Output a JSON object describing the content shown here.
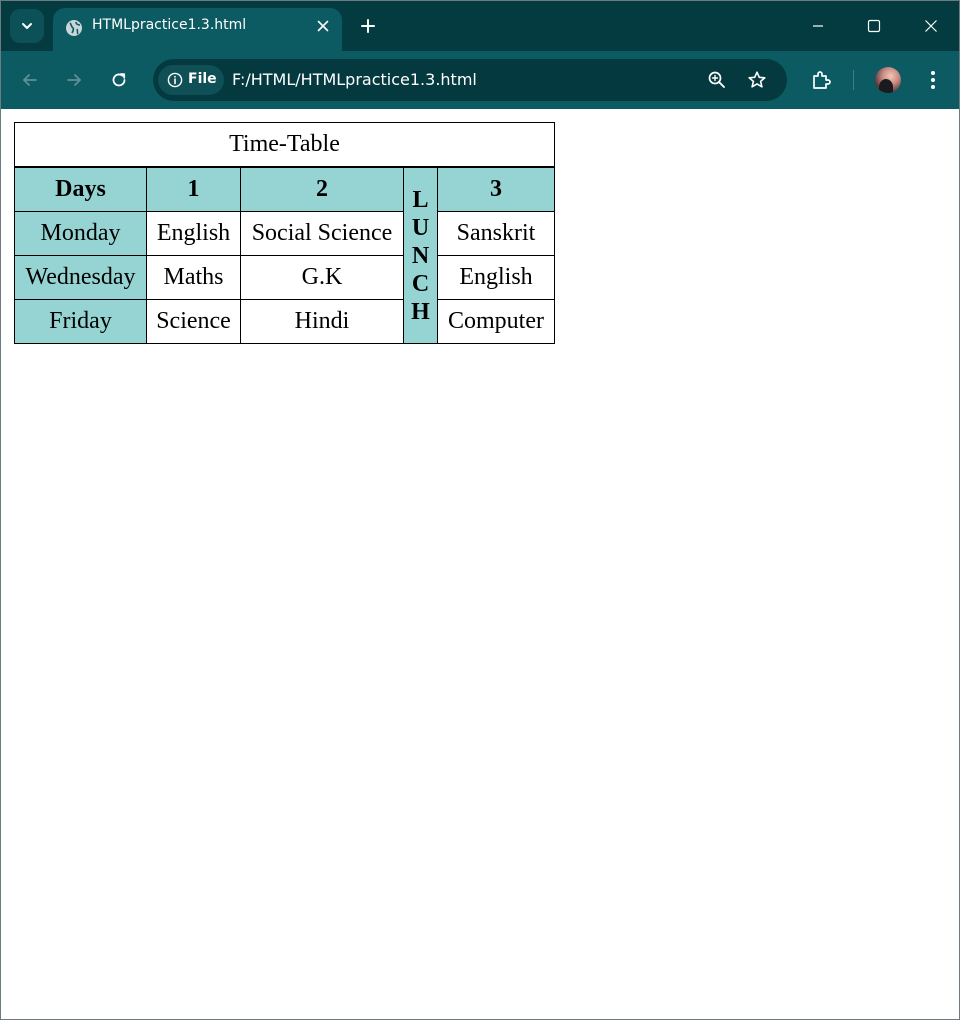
{
  "browser": {
    "tab": {
      "title": "HTMLpractice1.3.html",
      "favicon": "globe-icon"
    },
    "omnibox": {
      "site_chip_label": "File",
      "url": "F:/HTML/HTMLpractice1.3.html"
    },
    "colors": {
      "tabstrip_bg": "#033b41",
      "toolbar_bg": "#0c5a62",
      "omnibox_bg": "#03393f"
    }
  },
  "page": {
    "timetable": {
      "caption": "Time-Table",
      "header": {
        "days": "Days",
        "period_1": "1",
        "period_2": "2",
        "period_3": "3"
      },
      "lunch_letters": [
        "L",
        "U",
        "N",
        "C",
        "H"
      ],
      "rows": [
        {
          "day": "Monday",
          "p1": "English",
          "p2": "Social Science",
          "p3": "Sanskrit"
        },
        {
          "day": "Wednesday",
          "p1": "Maths",
          "p2": "G.K",
          "p3": "English"
        },
        {
          "day": "Friday",
          "p1": "Science",
          "p2": "Hindi",
          "p3": "Computer"
        }
      ],
      "colors": {
        "header_bg": "#96d4d4",
        "border": "#000000"
      }
    }
  }
}
